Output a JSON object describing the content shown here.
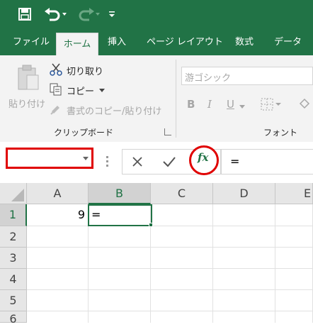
{
  "tabs": [
    "ファイル",
    "ホーム",
    "挿入",
    "ページ レイアウト",
    "数式",
    "データ"
  ],
  "clipboard": {
    "paste_label": "貼り付け",
    "cut_label": "切り取り",
    "copy_label": "コピー",
    "format_painter_label": "書式のコピー/貼り付け",
    "group_label": "クリップボード"
  },
  "font": {
    "font_name": "游ゴシック",
    "bold": "B",
    "italic": "I",
    "underline": "U",
    "group_label": "フォント"
  },
  "formula_bar": {
    "name_box_value": "",
    "fx_label": "fx",
    "formula_value": "="
  },
  "grid": {
    "columns": [
      "A",
      "B",
      "C",
      "D",
      "E"
    ],
    "rows": [
      "1",
      "2",
      "3",
      "4",
      "5",
      "6"
    ],
    "cells": {
      "A1": "9",
      "B1": "="
    },
    "active_column": "B",
    "active_row": "1"
  },
  "colors": {
    "accent": "#217346",
    "highlight_ring": "#e00000"
  },
  "icons": [
    "save-icon",
    "undo-icon",
    "redo-icon",
    "customize-qat-icon",
    "cut-icon",
    "copy-icon",
    "format-painter-icon",
    "paste-icon",
    "cancel-icon",
    "enter-icon",
    "insert-function-icon"
  ]
}
